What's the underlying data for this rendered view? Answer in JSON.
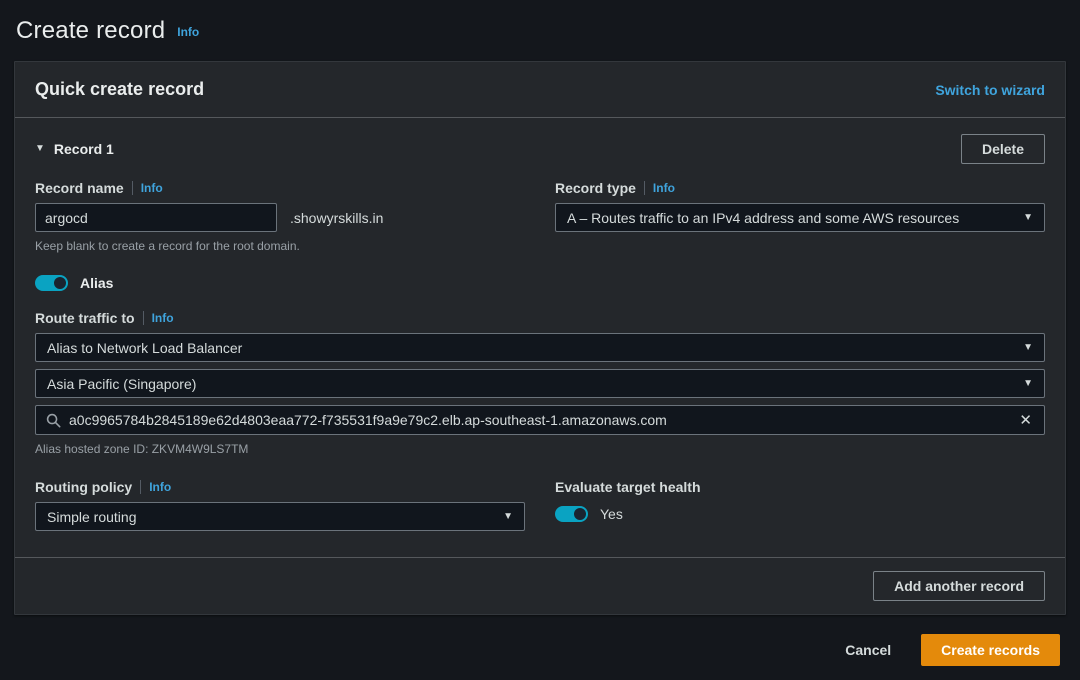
{
  "icons": {
    "caret": "▼",
    "collapse": "▼",
    "close": "✕"
  },
  "colors": {
    "accent_orange": "#e48a0b",
    "link_blue": "#3fa4dd",
    "toggle_on": "#0aa3c2"
  },
  "page": {
    "title": "Create record",
    "info": "Info"
  },
  "panel": {
    "header": {
      "title": "Quick create record",
      "switch_link": "Switch to wizard"
    },
    "record": {
      "title": "Record 1",
      "delete_button": "Delete",
      "record_name": {
        "label": "Record name",
        "info": "Info",
        "value": "argocd",
        "suffix": ".showyrskills.in",
        "helper": "Keep blank to create a record for the root domain."
      },
      "record_type": {
        "label": "Record type",
        "info": "Info",
        "value": "A – Routes traffic to an IPv4 address and some AWS resources"
      },
      "alias": {
        "label": "Alias",
        "state": "on"
      },
      "route_traffic": {
        "label": "Route traffic to",
        "info": "Info",
        "endpoint_value": "Alias to Network Load Balancer",
        "region_value": "Asia Pacific (Singapore)",
        "target_value": "a0c9965784b2845189e62d4803eaa772-f735531f9a9e79c2.elb.ap-southeast-1.amazonaws.com",
        "hosted_zone_note": "Alias hosted zone ID: ZKVM4W9LS7TM"
      },
      "routing_policy": {
        "label": "Routing policy",
        "info": "Info",
        "value": "Simple routing"
      },
      "evaluate_target_health": {
        "label": "Evaluate target health",
        "value": "Yes",
        "state": "on"
      }
    },
    "footer": {
      "add_button": "Add another record"
    }
  },
  "actions": {
    "cancel": "Cancel",
    "create": "Create records"
  }
}
